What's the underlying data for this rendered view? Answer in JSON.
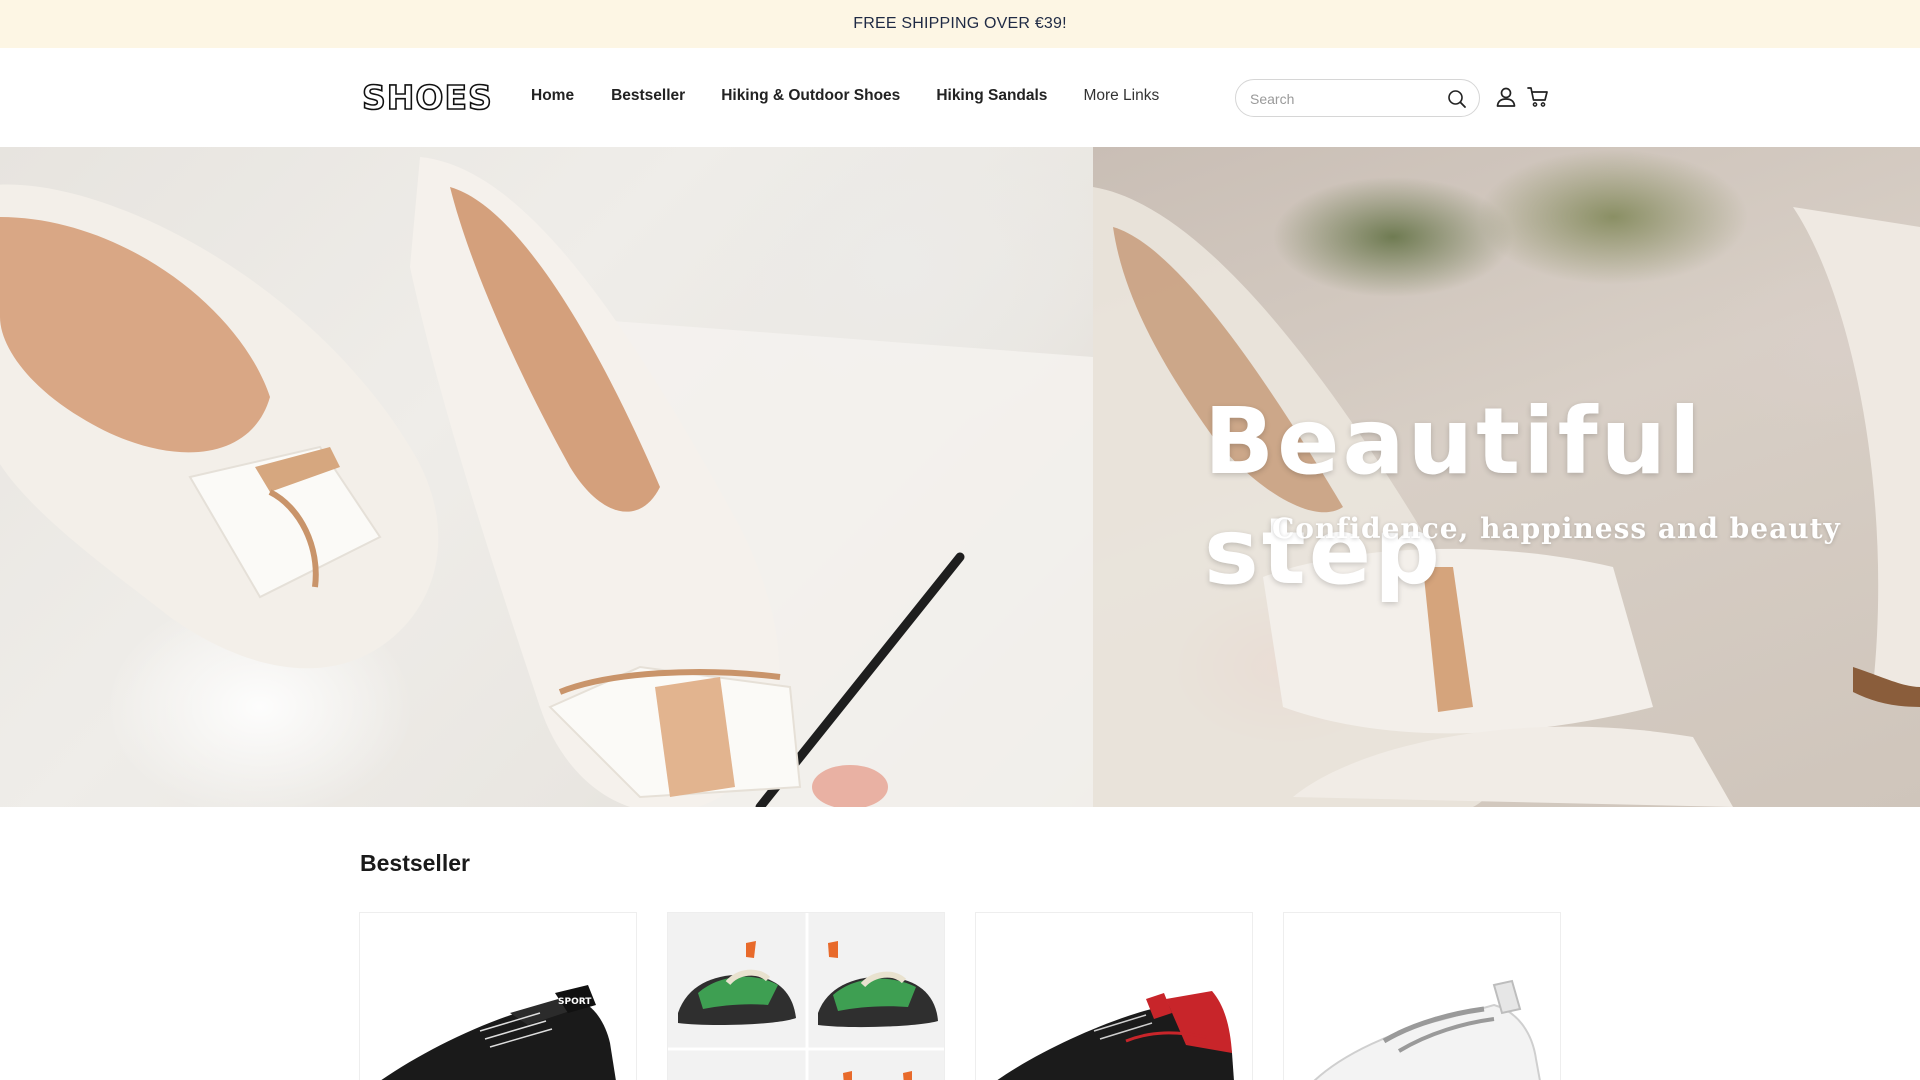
{
  "announcement": {
    "text": "FREE SHIPPING OVER €39!"
  },
  "header": {
    "logo": "SHOES",
    "nav": [
      {
        "label": "Home"
      },
      {
        "label": "Bestseller"
      },
      {
        "label": "Hiking & Outdoor Shoes"
      },
      {
        "label": "Hiking Sandals"
      },
      {
        "label": "More Links"
      }
    ],
    "search": {
      "placeholder": "Search",
      "value": ""
    },
    "icons": [
      "search-icon",
      "user-icon",
      "cart-icon"
    ]
  },
  "hero": {
    "title": "Beautiful step",
    "subtitle": "Confidence, happiness and beauty"
  },
  "bestseller": {
    "title": "Bestseller",
    "products": [
      {
        "image": "black-sport-sneaker"
      },
      {
        "image": "green-chunky-sneaker-grid"
      },
      {
        "image": "black-red-running-shoe"
      },
      {
        "image": "white-lace-sneaker"
      }
    ]
  },
  "colors": {
    "announcement_bg": "#fdf6e4",
    "announcement_text": "#1f2a44",
    "accent_red": "#c8252a"
  }
}
